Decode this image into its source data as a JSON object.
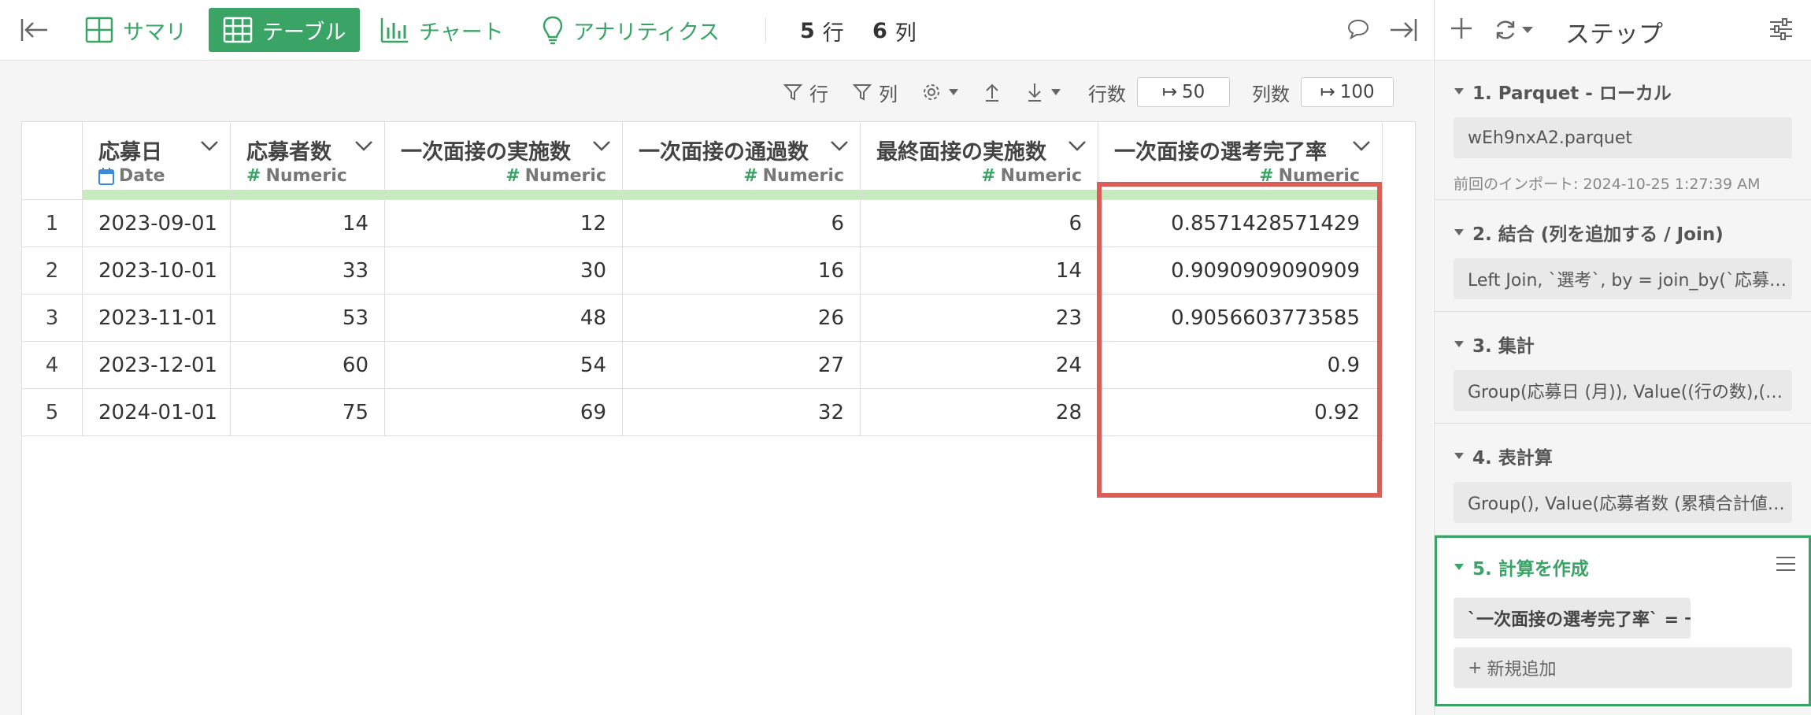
{
  "toolbar": {
    "tabs": [
      {
        "label": "サマリ",
        "icon": "summary-grid-icon",
        "active": false
      },
      {
        "label": "テーブル",
        "icon": "table-icon",
        "active": true
      },
      {
        "label": "チャート",
        "icon": "bar-chart-icon",
        "active": false
      },
      {
        "label": "アナリティクス",
        "icon": "lightbulb-icon",
        "active": false
      }
    ],
    "rows_count": "5",
    "rows_unit": "行",
    "cols_count": "6",
    "cols_unit": "列"
  },
  "subtoolbar": {
    "filter_rows": "行",
    "filter_cols": "列",
    "rows_label": "行数",
    "rows_value": "50",
    "cols_label": "列数",
    "cols_value": "100"
  },
  "table": {
    "columns": [
      {
        "name": "応募日",
        "type": "Date"
      },
      {
        "name": "応募者数",
        "type": "Numeric"
      },
      {
        "name": "一次面接の実施数",
        "type": "Numeric"
      },
      {
        "name": "一次面接の通過数",
        "type": "Numeric"
      },
      {
        "name": "最終面接の実施数",
        "type": "Numeric"
      },
      {
        "name": "一次面接の選考完了率",
        "type": "Numeric"
      }
    ],
    "rows": [
      {
        "n": "1",
        "c": [
          "2023-09-01",
          "14",
          "12",
          "6",
          "6",
          "0.8571428571429"
        ]
      },
      {
        "n": "2",
        "c": [
          "2023-10-01",
          "33",
          "30",
          "16",
          "14",
          "0.9090909090909"
        ]
      },
      {
        "n": "3",
        "c": [
          "2023-11-01",
          "53",
          "48",
          "26",
          "23",
          "0.9056603773585"
        ]
      },
      {
        "n": "4",
        "c": [
          "2023-12-01",
          "60",
          "54",
          "27",
          "24",
          "0.9"
        ]
      },
      {
        "n": "5",
        "c": [
          "2024-01-01",
          "75",
          "69",
          "32",
          "28",
          "0.92"
        ]
      }
    ]
  },
  "steps_panel": {
    "title": "ステップ",
    "steps": [
      {
        "title": "1. Parquet - ローカル",
        "detail": "wEh9nxA2.parquet",
        "meta": "前回のインポート: 2024-10-25 1:27:39 AM"
      },
      {
        "title": "2. 結合 (列を追加する / Join)",
        "detail": "Left Join, `選考`, by = join_by(`応募…"
      },
      {
        "title": "3. 集計",
        "detail": "Group(応募日 (月)), Value((行の数),(…"
      },
      {
        "title": "4. 表計算",
        "detail": "Group(), Value(応募者数 (累積合計値…"
      },
      {
        "title": "5. 計算を作成",
        "detail": "`一次面接の選考完了率` = 一…",
        "add_new": "新規追加"
      }
    ]
  },
  "colors": {
    "accent": "#3aa466",
    "highlight": "#d85f58",
    "type_bar": "#c6ebbf"
  }
}
